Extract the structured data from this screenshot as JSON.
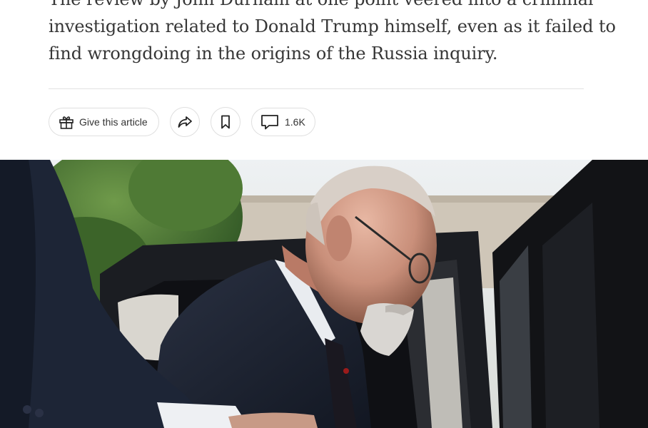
{
  "article": {
    "summary_lines": [
      "The review by John Durham at one point veered into a criminal",
      "investigation related to Donald Trump himself, even as it failed to",
      "find wrongdoing in the origins of the Russia inquiry."
    ]
  },
  "toolbar": {
    "gift_label": "Give this article",
    "gift_icon": "gift-icon",
    "share_icon": "share-icon",
    "bookmark_icon": "bookmark-icon",
    "comments_icon": "comment-icon",
    "comments_count": "1.6K"
  },
  "photo": {
    "description_icon": "photo"
  },
  "colors": {
    "text": "#363636",
    "rule": "#e2e2e2",
    "pill_border": "#dfdfdf"
  }
}
